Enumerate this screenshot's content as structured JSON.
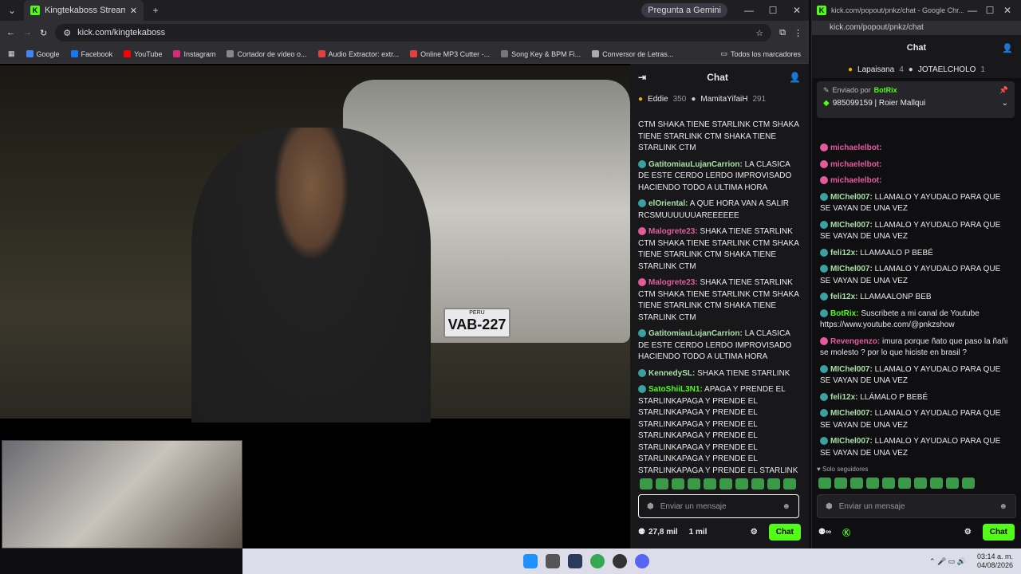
{
  "browser": {
    "tab_title": "Kingtekaboss Stream - Watch",
    "url": "kick.com/kingtekaboss",
    "gemini_label": "Pregunta a Gemini",
    "bookmarks": [
      "Google",
      "Facebook",
      "YouTube",
      "Instagram",
      "Cortador de vídeo o...",
      "Audio Extractor: extr...",
      "Online MP3 Cutter -...",
      "Song Key & BPM Fi...",
      "Conversor de Letras..."
    ],
    "all_bookmarks": "Todos los marcadores"
  },
  "stream": {
    "plate": "VAB-227",
    "plate_top": "PERU"
  },
  "chat": {
    "title": "Chat",
    "leaders": [
      {
        "name": "Eddie",
        "count": "350"
      },
      {
        "name": "MamitaYifaiH",
        "count": "291"
      }
    ],
    "messages": [
      {
        "user": "",
        "text": "CTM SHAKA TIENE STARLINK CTM SHAKA TIENE STARLINK CTM SHAKA TIENE STARLINK CTM",
        "color": "#fff"
      },
      {
        "user": "GatitomiauLujanCarrion:",
        "text": "LA CLASICA DE ESTE CERDO LERDO IMPROVISADO HACIENDO TODO A ULTIMA HORA",
        "color": "#a8e0a8"
      },
      {
        "user": "elOriental:",
        "text": "A QUE HORA VAN A SALIR RCSMUUUUUUAREEEEEE",
        "color": "#a8e0a8"
      },
      {
        "user": "Malogrete23:",
        "text": "SHAKA TIENE STARLINK CTM SHAKA TIENE STARLINK CTM SHAKA TIENE STARLINK CTM SHAKA TIENE STARLINK CTM",
        "color": "#e45b9d"
      },
      {
        "user": "Malogrete23:",
        "text": "SHAKA TIENE STARLINK CTM SHAKA TIENE STARLINK CTM SHAKA TIENE STARLINK CTM SHAKA TIENE STARLINK CTM",
        "color": "#e45b9d"
      },
      {
        "user": "GatitomiauLujanCarrion:",
        "text": "LA CLASICA DE ESTE CERDO LERDO IMPROVISADO HACIENDO TODO A ULTIMA HORA",
        "color": "#a8e0a8"
      },
      {
        "user": "KennedySL:",
        "text": "SHAKA TIENE STARLINK",
        "color": "#a8e0a8"
      },
      {
        "user": "SatoShiiL3N1:",
        "text": "APAGA Y PRENDE EL STARLINKAPAGA Y PRENDE EL STARLINKAPAGA Y PRENDE EL STARLINKAPAGA Y PRENDE EL STARLINKAPAGA Y PRENDE EL STARLINKAPAGA Y PRENDE EL STARLINKAPAGA Y PRENDE EL STARLINKAPAGA Y PRENDE EL STARLINK",
        "color": "#53fc18"
      }
    ],
    "placeholder": "Enviar un mensaje",
    "viewers": "27,8 mil",
    "followers": "1 mil",
    "chat_button": "Chat"
  },
  "popout": {
    "title": "kick.com/popout/pnkz/chat - Google Chr...",
    "url": "kick.com/popout/pnkz/chat",
    "chat_title": "Chat",
    "leaders": [
      {
        "name": "Lapaisana",
        "count": "4"
      },
      {
        "name": "JOTAELCHOLO",
        "count": "1"
      }
    ],
    "pinned_by": "Enviado por",
    "pinned_user": "BotRix",
    "pinned_text": "985099159 | Roier Mallqui",
    "messages": [
      {
        "user": "michaelelbot:",
        "text": "",
        "color": "#e45b9d"
      },
      {
        "user": "michaelelbot:",
        "text": "",
        "color": "#e45b9d"
      },
      {
        "user": "michaelelbot:",
        "text": "",
        "color": "#e45b9d"
      },
      {
        "user": "MIChel007:",
        "text": "LLAMALO Y AYUDALO PARA QUE SE VAYAN DE UNA VEZ",
        "color": "#a8e0a8"
      },
      {
        "user": "MIChel007:",
        "text": "LLAMALO Y AYUDALO PARA QUE SE VAYAN DE UNA VEZ",
        "color": "#a8e0a8"
      },
      {
        "user": "feli12x:",
        "text": "LLAMAALO P BEBÉ",
        "color": "#a8e0a8"
      },
      {
        "user": "MIChel007:",
        "text": "LLAMALO Y AYUDALO PARA QUE SE VAYAN DE UNA VEZ",
        "color": "#a8e0a8"
      },
      {
        "user": "feli12x:",
        "text": "LLAMAALONP BEB",
        "color": "#a8e0a8"
      },
      {
        "user": "BotRix:",
        "text": "Suscribete a mi canal de Youtube https://www.youtube.com/@pnkzshow",
        "color": "#53fc18"
      },
      {
        "user": "Revengenzo:",
        "text": "imura porque ñato que paso la ñañi se molesto ? por lo que hiciste en brasil ?",
        "color": "#e45b9d"
      },
      {
        "user": "MIChel007:",
        "text": "LLAMALO Y AYUDALO PARA QUE SE VAYAN DE UNA VEZ",
        "color": "#a8e0a8"
      },
      {
        "user": "feli12x:",
        "text": "LLÁMALO P BEBÉ",
        "color": "#a8e0a8"
      },
      {
        "user": "MIChel007:",
        "text": "LLAMALO Y AYUDALO PARA QUE SE VAYAN DE UNA VEZ",
        "color": "#a8e0a8"
      },
      {
        "user": "MIChel007:",
        "text": "LLAMALO Y AYUDALO PARA QUE SE VAYAN DE UNA VEZ",
        "color": "#a8e0a8"
      }
    ],
    "followers_only": "Solo seguidores",
    "placeholder": "Enviar un mensaje",
    "chat_button": "Chat"
  },
  "taskbar": {
    "time": "03:14 a. m.",
    "date": "04/08/2026"
  }
}
